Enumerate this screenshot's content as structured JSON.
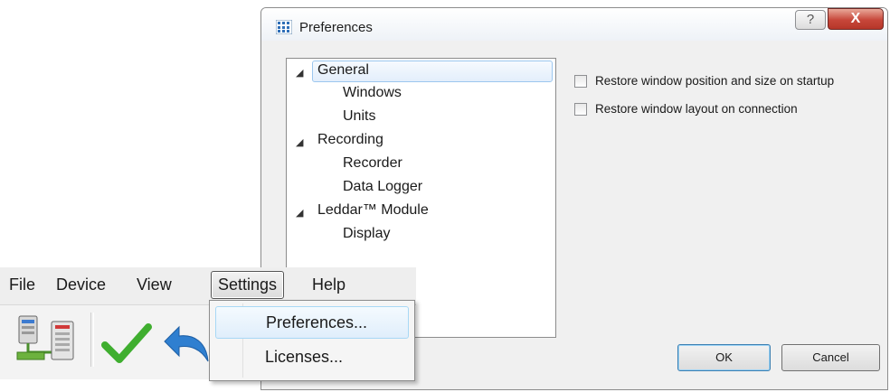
{
  "dialog": {
    "title": "Preferences",
    "help_glyph": "?",
    "close_glyph": "X",
    "tree": [
      {
        "label": "General",
        "expanded": true,
        "selected": true,
        "children": [
          "Windows",
          "Units"
        ]
      },
      {
        "label": "Recording",
        "expanded": true,
        "selected": false,
        "children": [
          "Recorder",
          "Data Logger"
        ]
      },
      {
        "label": "Leddar™ Module",
        "expanded": true,
        "selected": false,
        "children": [
          "Display"
        ]
      }
    ],
    "options": [
      {
        "label": "Restore window position and size on startup",
        "checked": false
      },
      {
        "label": "Restore window layout on connection",
        "checked": false
      }
    ],
    "ok_label": "OK",
    "cancel_label": "Cancel"
  },
  "app": {
    "menu": [
      "File",
      "Device",
      "View",
      "Settings",
      "Help"
    ],
    "active_menu": "Settings",
    "toolbar_icons": [
      "network-devices-icon",
      "checkmark-icon",
      "undo-arrow-icon"
    ],
    "settings_menu": [
      {
        "label": "Preferences...",
        "highlighted": true
      },
      {
        "label": "Licenses...",
        "highlighted": false
      }
    ]
  },
  "colors": {
    "accent_selection": "#9cc7ef",
    "close_button": "#c7473a",
    "check_green": "#3fae2f",
    "undo_blue": "#2f7fd0"
  }
}
